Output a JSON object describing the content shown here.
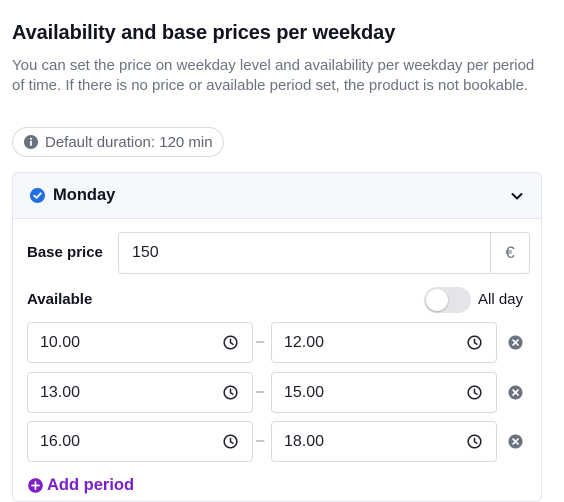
{
  "title": "Availability and base prices per weekday",
  "description": "You can set the price on weekday level and availability per weekday per period of time. If there is no price or available period set, the product is not bookable.",
  "default_duration": "Default duration: 120 min",
  "day": {
    "name": "Monday",
    "base_price_label": "Base price",
    "base_price_value": "150",
    "currency": "€",
    "available_label": "Available",
    "all_day_label": "All day",
    "all_day_on": false,
    "periods": [
      {
        "from": "10.00",
        "to": "12.00"
      },
      {
        "from": "13.00",
        "to": "15.00"
      },
      {
        "from": "16.00",
        "to": "18.00"
      }
    ],
    "separator": "–",
    "add_period_label": "Add period"
  },
  "colors": {
    "accent_check": "#1f6fe0",
    "add_period": "#7c1fc9",
    "header_bg": "#f5f8fd"
  },
  "icons": [
    "info-icon",
    "check-circle-icon",
    "chevron-down-icon",
    "clock-icon",
    "remove-circle-icon",
    "plus-circle-icon"
  ]
}
